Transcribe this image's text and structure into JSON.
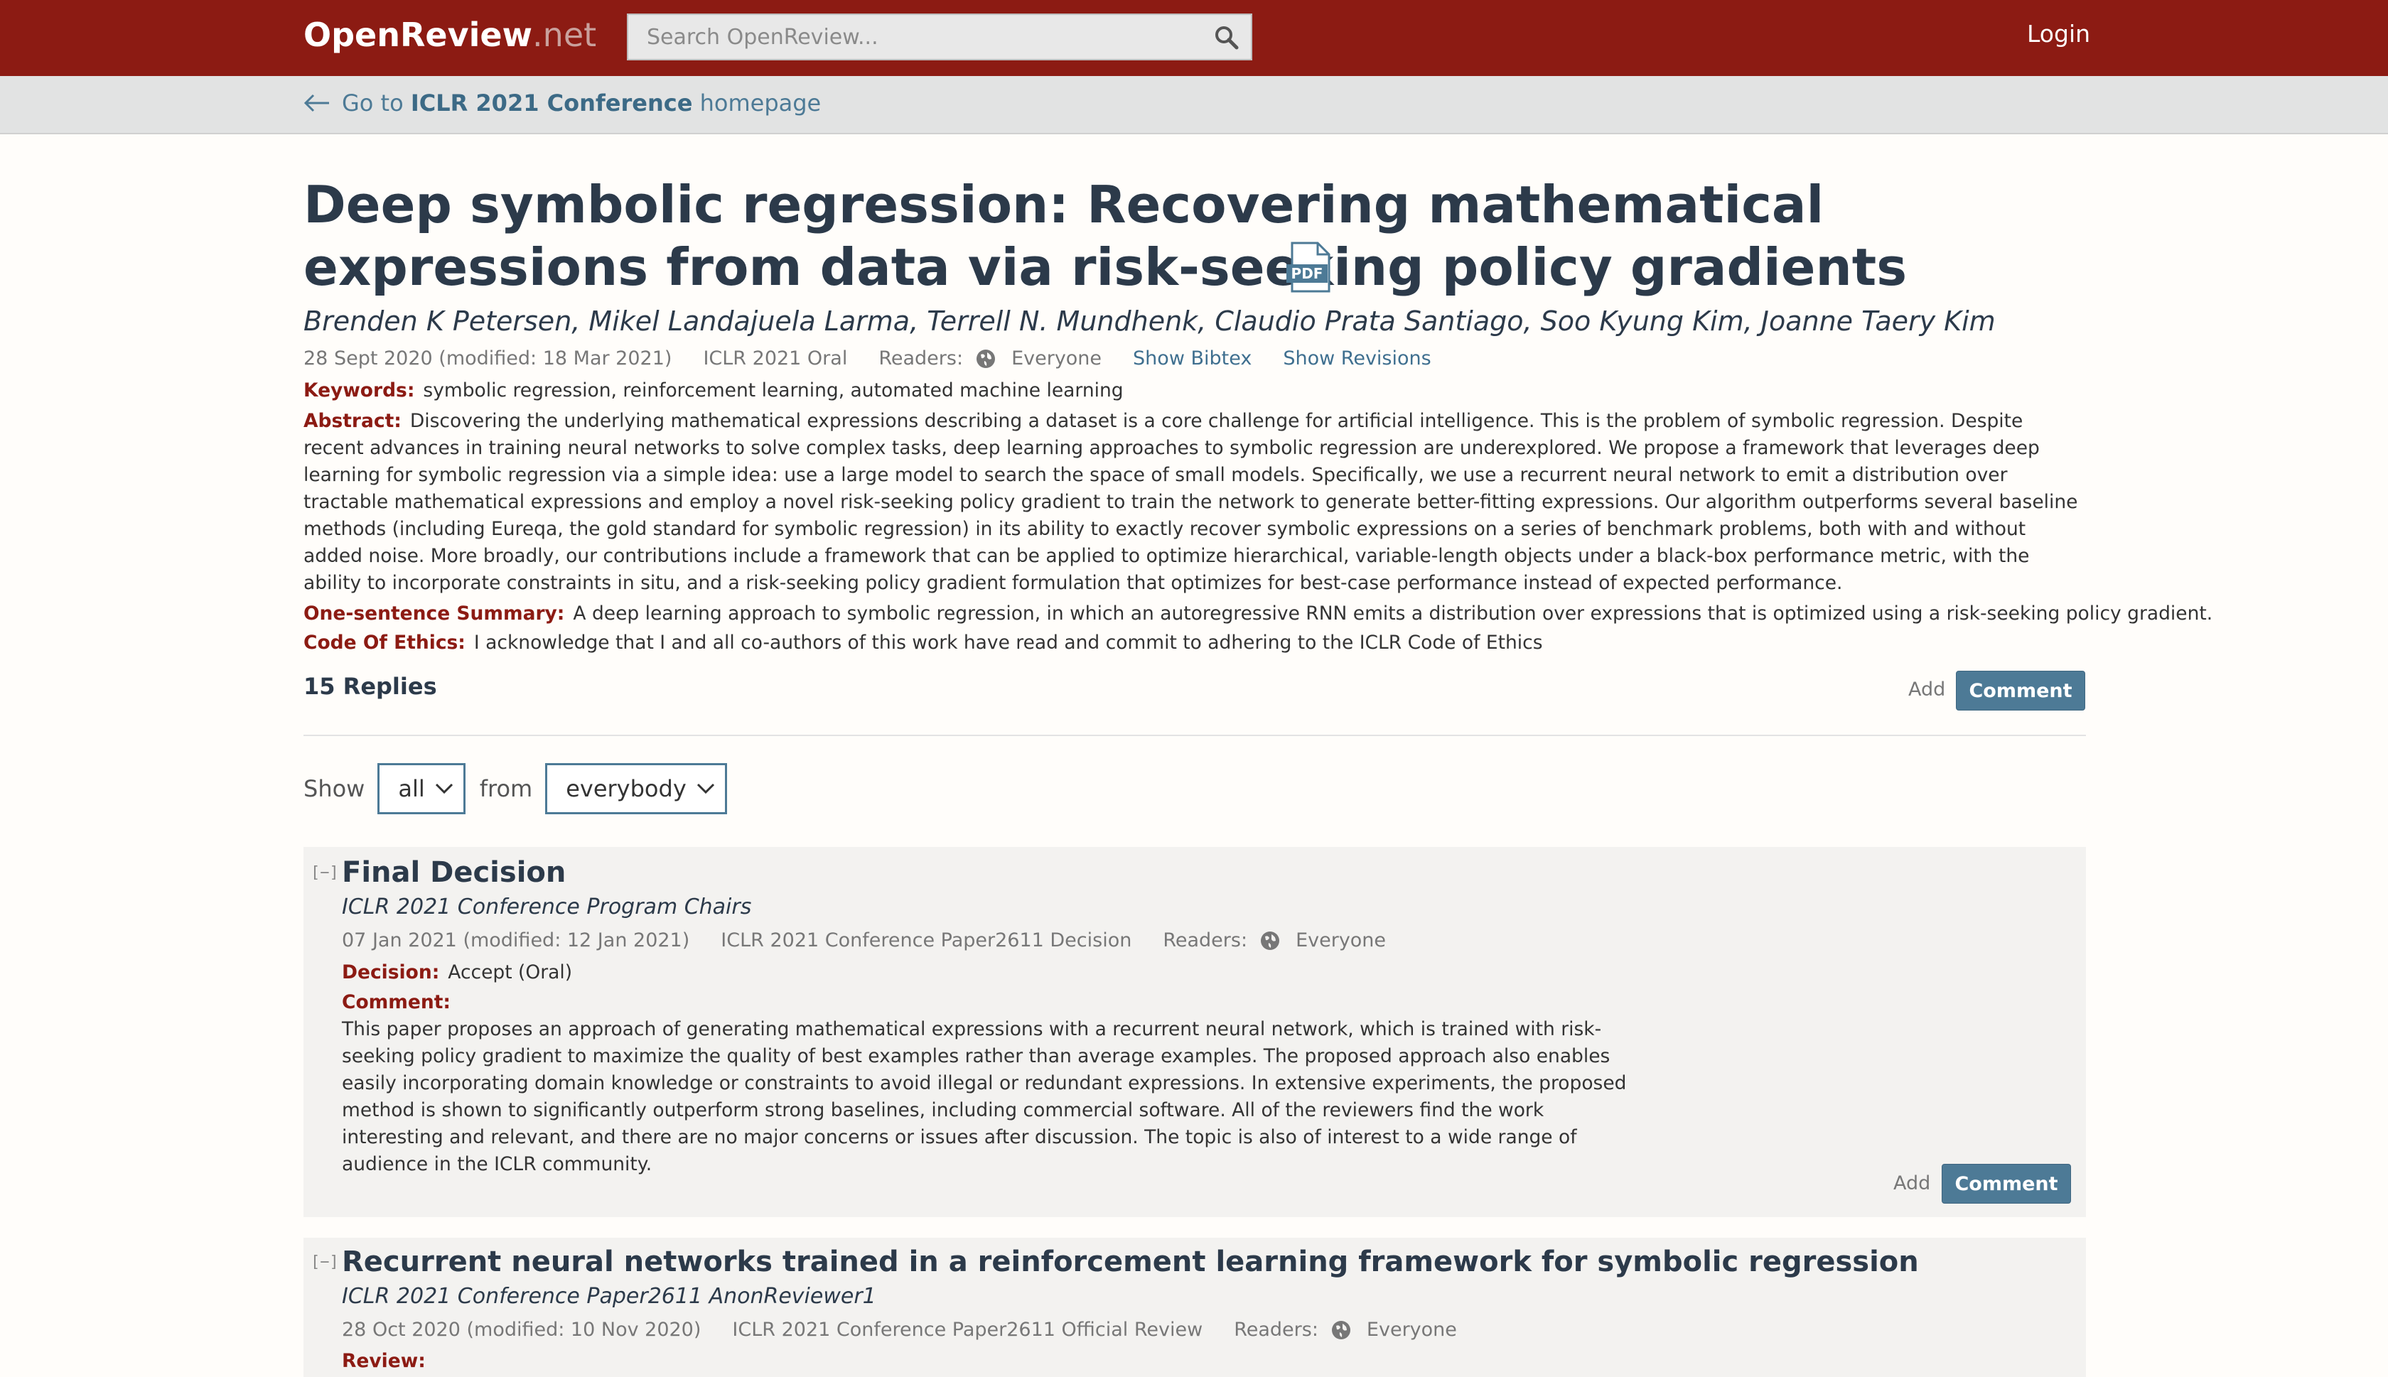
{
  "nav": {
    "brand_main": "OpenReview",
    "brand_tld": ".net",
    "search_placeholder": "Search OpenReview...",
    "login": "Login"
  },
  "subbar": {
    "prefix": "Go to ",
    "venue": "ICLR 2021 Conference",
    "suffix": " homepage"
  },
  "paper": {
    "title": "Deep symbolic regression: Recovering mathematical expressions from data via risk-seeking policy gradients",
    "authors": "Brenden K Petersen, Mikel Landajuela Larma, Terrell N. Mundhenk, Claudio Prata Santiago, Soo Kyung Kim, Joanne Taery Kim",
    "date": "28 Sept 2020 (modified: 18 Mar 2021)",
    "venue": "ICLR 2021 Oral",
    "readers_label": "Readers:",
    "readers": "Everyone",
    "show_bibtex": "Show Bibtex",
    "show_revisions": "Show Revisions",
    "keywords_label": "Keywords:",
    "keywords": "symbolic regression, reinforcement learning, automated machine learning",
    "abstract_label": "Abstract:",
    "abstract": "Discovering the underlying mathematical expressions describing a dataset is a core challenge for artificial intelligence. This is the problem of symbolic regression. Despite recent advances in training neural networks to solve complex tasks, deep learning approaches to symbolic regression are underexplored. We propose a framework that leverages deep learning for symbolic regression via a simple idea: use a large model to search the space of small models. Specifically, we use a recurrent neural network to emit a distribution over tractable mathematical expressions and employ a novel risk-seeking policy gradient to train the network to generate better-fitting expressions. Our algorithm outperforms several baseline methods (including Eureqa, the gold standard for symbolic regression) in its ability to exactly recover symbolic expressions on a series of benchmark problems, both with and without added noise. More broadly, our contributions include a framework that can be applied to optimize hierarchical, variable-length objects under a black-box performance metric, with the ability to incorporate constraints in situ, and a risk-seeking policy gradient formulation that optimizes for best-case performance instead of expected performance.",
    "summary_label": "One-sentence Summary:",
    "summary": "A deep learning approach to symbolic regression, in which an autoregressive RNN emits a distribution over expressions that is optimized using a risk-seeking policy gradient.",
    "ethics_label": "Code Of Ethics:",
    "ethics": "I acknowledge that I and all co-authors of this work have read and commit to adhering to the ICLR Code of Ethics"
  },
  "thread": {
    "replies": "15 Replies",
    "add_label": "Add",
    "comment_button": "Comment",
    "show_label": "Show",
    "show_value": "all",
    "from_label": "from",
    "from_value": "everybody"
  },
  "notes": [
    {
      "collapse": "[−]",
      "title": "Final Decision",
      "signature": "ICLR 2021 Conference Program Chairs",
      "date": "07 Jan 2021 (modified: 12 Jan 2021)",
      "invitation": "ICLR 2021 Conference Paper2611 Decision",
      "readers_label": "Readers:",
      "readers": "Everyone",
      "decision_label": "Decision:",
      "decision": "Accept (Oral)",
      "comment_label": "Comment:",
      "comment": "This paper proposes an approach of generating mathematical expressions with a recurrent neural network, which is trained with risk-seeking policy gradient to maximize the quality of best examples rather than average examples. The proposed approach also enables easily incorporating domain knowledge or constraints to avoid illegal or redundant expressions. In extensive experiments, the proposed method is shown to significantly outperform strong baselines, including commercial software. All of the reviewers find the work interesting and relevant, and there are no major concerns or issues after discussion. The topic is also of interest to a wide range of audience in the ICLR community.",
      "add_label": "Add",
      "comment_button": "Comment"
    },
    {
      "collapse": "[−]",
      "title": "Recurrent neural networks trained in a reinforcement learning framework for symbolic regression",
      "signature": "ICLR 2021 Conference Paper2611 AnonReviewer1",
      "date": "28 Oct 2020 (modified: 10 Nov 2020)",
      "invitation": "ICLR 2021 Conference Paper2611 Official Review",
      "readers_label": "Readers:",
      "readers": "Everyone",
      "review_label": "Review:"
    }
  ]
}
